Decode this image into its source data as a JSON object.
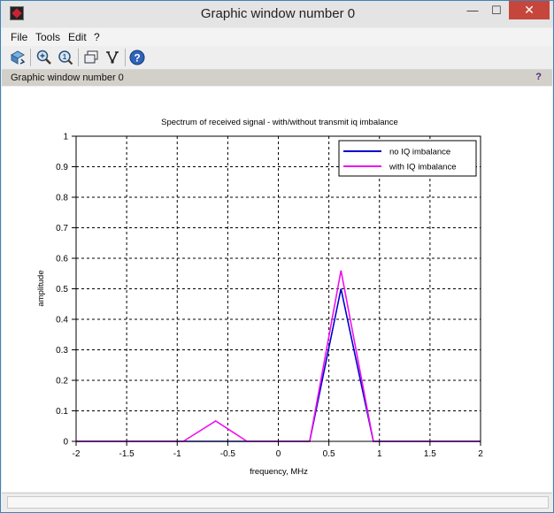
{
  "window": {
    "title": "Graphic window number 0",
    "minimize_glyph": "—",
    "maximize_glyph": "☐",
    "close_glyph": "✕"
  },
  "menu": {
    "items": [
      "File",
      "Tools",
      "Edit",
      "?"
    ]
  },
  "toolbar": {
    "icons": [
      "rotate-icon",
      "zoom-in-icon",
      "zoom-out-icon",
      "datatip-icon",
      "edit-plot-icon",
      "help-icon"
    ]
  },
  "infobar": {
    "label": "Graphic window number 0",
    "help": "?"
  },
  "chart_data": {
    "type": "line",
    "title": "Spectrum of received signal - with/without transmit iq imbalance",
    "xlabel": "frequency, MHz",
    "ylabel": "amplitude",
    "xlim": [
      -2,
      2
    ],
    "ylim": [
      0,
      1
    ],
    "xticks": [
      -2,
      -1.5,
      -1,
      -0.5,
      0,
      0.5,
      1,
      1.5,
      2
    ],
    "xtick_labels": [
      "-2",
      "-1.5",
      "-1",
      "-0.5",
      "0",
      "0.5",
      "1",
      "1.5",
      "2"
    ],
    "yticks": [
      0,
      0.1,
      0.2,
      0.3,
      0.4,
      0.5,
      0.6,
      0.7,
      0.8,
      0.9,
      1
    ],
    "ytick_labels": [
      "0",
      "0.1",
      "0.2",
      "0.3",
      "0.4",
      "0.5",
      "0.6",
      "0.7",
      "0.8",
      "0.9",
      "1"
    ],
    "grid": true,
    "legend": "top-right",
    "series": [
      {
        "name": "no IQ imbalance",
        "color": "#0000cc",
        "x": [
          -2,
          -1.25,
          -0.94,
          -0.62,
          -0.31,
          0,
          0.31,
          0.62,
          0.94,
          1.25,
          2
        ],
        "y": [
          0,
          0,
          0,
          0,
          0,
          0,
          0,
          0.5,
          0,
          0,
          0
        ]
      },
      {
        "name": "with IQ imbalance",
        "color": "#ee11ee",
        "x": [
          -2,
          -1.25,
          -0.94,
          -0.62,
          -0.31,
          0,
          0.31,
          0.62,
          0.94,
          1.25,
          2
        ],
        "y": [
          0,
          0,
          0,
          0.067,
          0,
          0,
          0,
          0.56,
          0,
          0,
          0
        ]
      }
    ]
  }
}
